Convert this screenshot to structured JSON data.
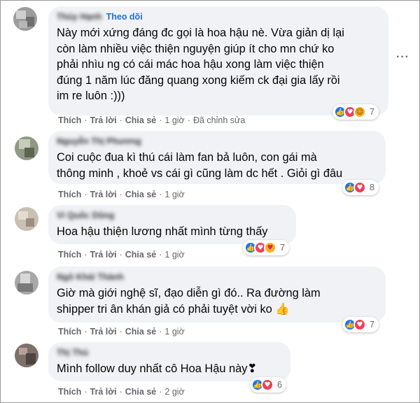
{
  "comments": [
    {
      "author": "Thủy Hạnh",
      "follow_label": "Theo dõi",
      "text": "Này mới xứng đáng đc gọi là hoa hậu nè. Vừa giản dị lại\ncòn làm nhiều việc thiện nguyện giúp ít cho mn chứ ko\nphải nhìu ng có cái mác hoa hậu xong làm việc thiện\nđúng 1 năm lúc đăng quang xong kiếm ck đại gia lấy rồi\nim re luôn :)))",
      "reaction_count": "7",
      "reactions": [
        "like-icon",
        "love-icon",
        "haha-icon"
      ],
      "actions": {
        "like": "Thích",
        "reply": "Trả lời",
        "share": "Chia sẻ",
        "time": "1 giờ",
        "edited": "Đã chỉnh sửa"
      }
    },
    {
      "author": "Nguyễn Thị Phương",
      "text": "Coi cuộc đua kì thú cái làm fan bả luôn, con gái mà\nthông minh , khoẻ vs cái gì cũng làm dc hết . Giỏi gì đâu",
      "reaction_count": "8",
      "reactions": [
        "like-icon",
        "love-icon"
      ],
      "actions": {
        "like": "Thích",
        "reply": "Trả lời",
        "share": "Chia sẻ",
        "time": "1 giờ"
      }
    },
    {
      "author": "Vi Quốc Dũng",
      "text": "Hoa hậu thiện lương nhất mình từng thấy",
      "reaction_count": "7",
      "reactions": [
        "like-icon",
        "love-icon",
        "care-icon"
      ],
      "actions": {
        "like": "Thích",
        "reply": "Trả lời",
        "share": "Chia sẻ",
        "time": "1 giờ"
      }
    },
    {
      "author": "Ngô Khải Thành",
      "text": "Giờ mà giới nghệ sĩ, đạo diễn gì đó.. Ra đường làm\nshipper tri ân khán giả có phải tuyệt vời ko 👍",
      "reaction_count": "7",
      "reactions": [
        "like-icon",
        "love-icon"
      ],
      "actions": {
        "like": "Thích",
        "reply": "Trả lời",
        "share": "Chia sẻ",
        "time": "1 giờ"
      }
    },
    {
      "author": "Thị Thủ",
      "text": "Mình follow duy nhất cô Hoa Hậu này❣",
      "reaction_count": "6",
      "reactions": [
        "like-icon",
        "love-icon"
      ],
      "actions": {
        "like": "Thích",
        "reply": "Trả lời",
        "share": "Chia sẻ",
        "time": "2 giờ"
      }
    }
  ],
  "more_icon": "more-horizontal-icon",
  "colors": {
    "bubble": "#f0f2f5",
    "link": "#216fdb",
    "meta": "#65676b",
    "like": "#1877f2",
    "love": "#f33e58",
    "haha": "#f7b125"
  }
}
